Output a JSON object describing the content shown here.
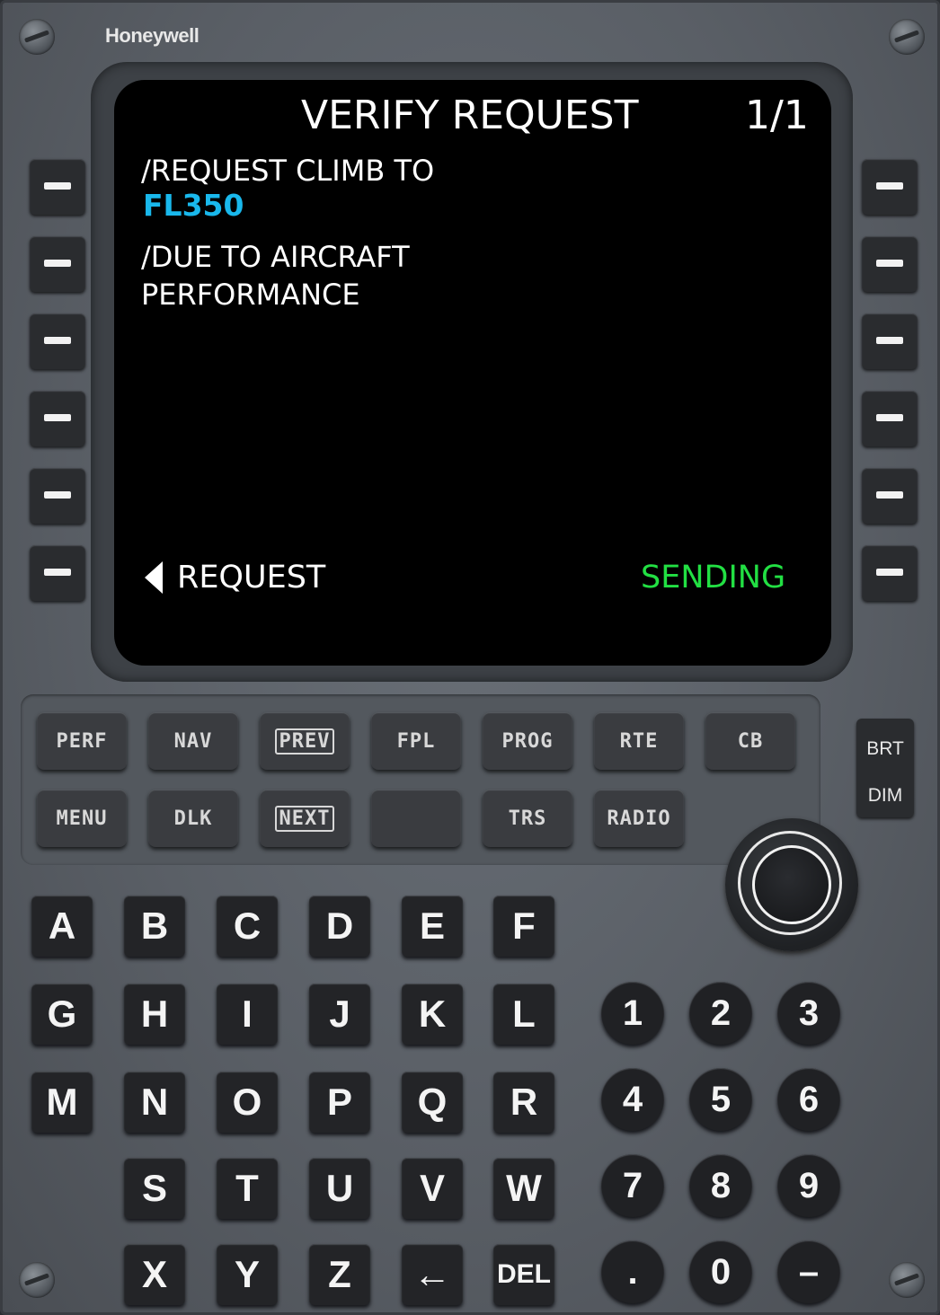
{
  "brand": "Honeywell",
  "screen": {
    "title": "VERIFY REQUEST",
    "page": "1/1",
    "line1_label": "/REQUEST CLIMB TO",
    "line1_value": "FL350",
    "line2_label": "/DUE TO AIRCRAFT",
    "line2_value": "PERFORMANCE",
    "bottom_left": "REQUEST",
    "bottom_right": "SENDING",
    "colors": {
      "text": "#ffffff",
      "value": "#19b8ec",
      "status": "#22e043"
    }
  },
  "function_keys": {
    "row1": [
      "PERF",
      "NAV",
      "PREV",
      "FPL",
      "PROG",
      "RTE",
      "CB"
    ],
    "row2": [
      "MENU",
      "DLK",
      "NEXT",
      "",
      "TRS",
      "RADIO"
    ]
  },
  "brightness": {
    "top": "BRT",
    "bottom": "DIM"
  },
  "alpha_keys": {
    "row1": [
      "A",
      "B",
      "C",
      "D",
      "E",
      "F"
    ],
    "row2": [
      "G",
      "H",
      "I",
      "J",
      "K",
      "L"
    ],
    "row3": [
      "M",
      "N",
      "O",
      "P",
      "Q",
      "R"
    ],
    "row4": [
      "S",
      "T",
      "U",
      "V",
      "W"
    ],
    "row5": [
      "X",
      "Y",
      "Z",
      "←",
      "DEL"
    ]
  },
  "numeric_keys": {
    "row1": [
      "1",
      "2",
      "3"
    ],
    "row2": [
      "4",
      "5",
      "6"
    ],
    "row3": [
      "7",
      "8",
      "9"
    ],
    "row4": [
      ".",
      "0",
      "–"
    ]
  }
}
